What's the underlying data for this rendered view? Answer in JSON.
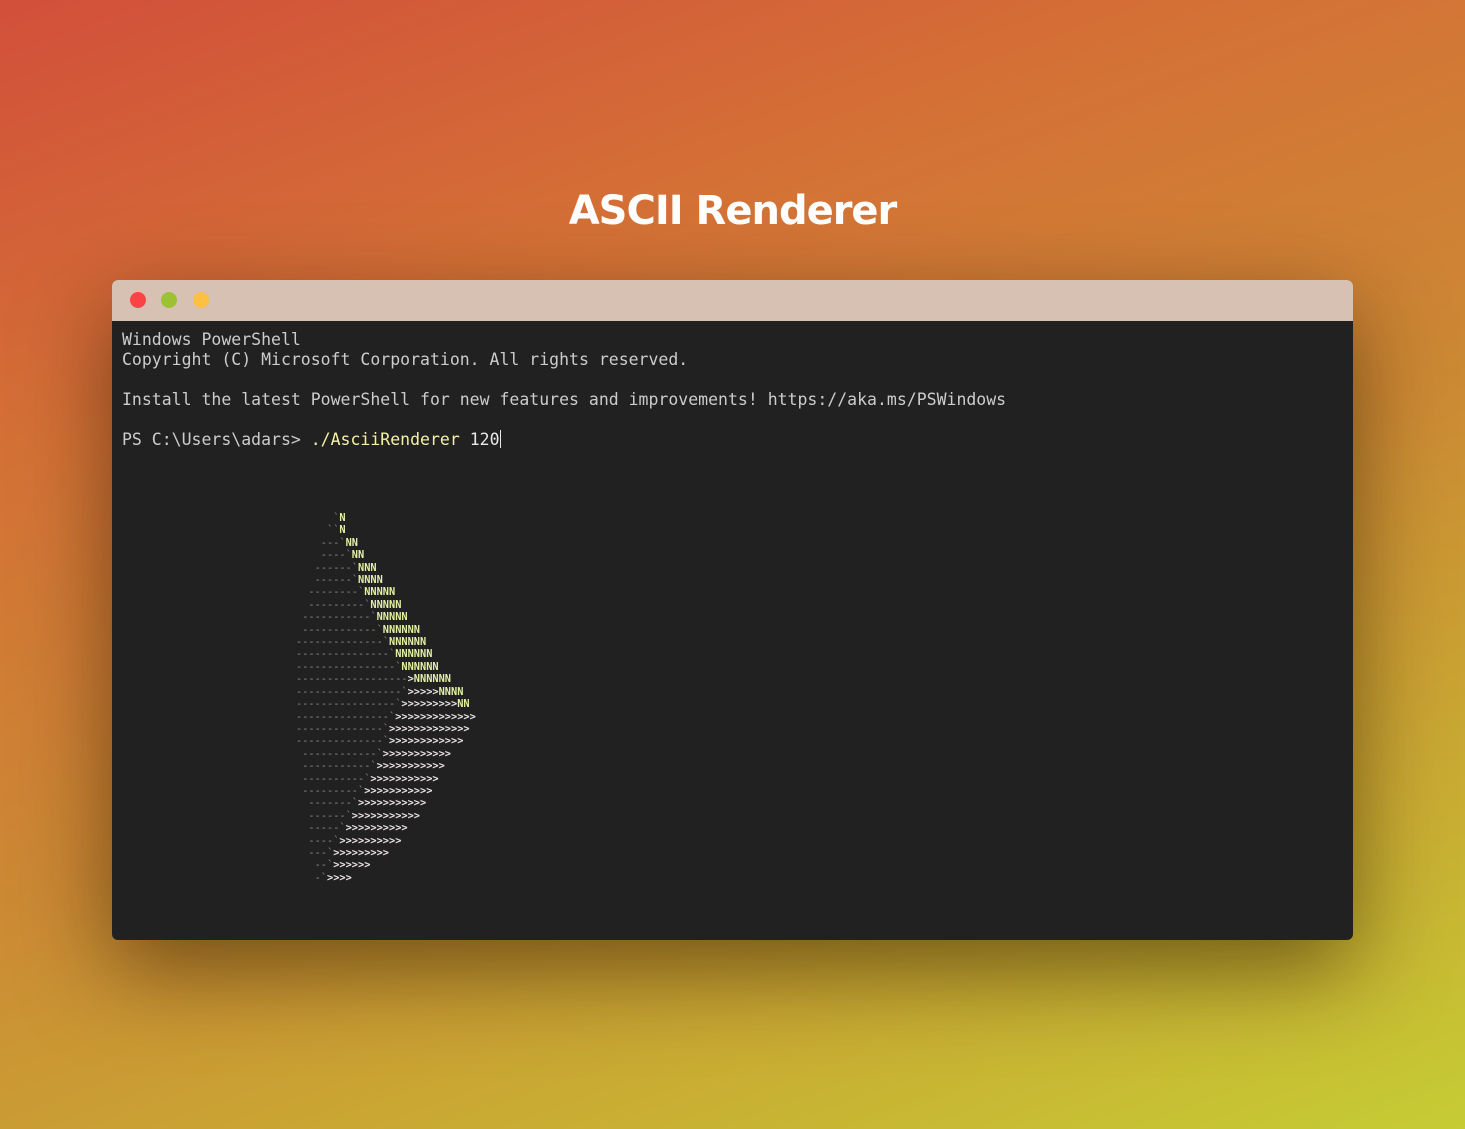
{
  "page": {
    "title": "ASCII Renderer"
  },
  "window": {
    "buttons": {
      "close": "close-button",
      "minimize": "minimize-button",
      "maximize": "maximize-button"
    },
    "colors": {
      "close": "#fb4346",
      "minimize": "#9dc134",
      "maximize": "#fdbf44",
      "titlebar": "#d6c1b2",
      "terminal_bg": "#212121"
    }
  },
  "terminal": {
    "header_line1": "Windows PowerShell",
    "header_line2": "Copyright (C) Microsoft Corporation. All rights reserved.",
    "install_line": "Install the latest PowerShell for new features and improvements! https://aka.ms/PSWindows",
    "prompt": "PS C:\\Users\\adars> ",
    "command": "./AsciiRenderer",
    "argument": " 120",
    "ascii_art": [
      "      `N",
      "     ``N",
      "    ---`NN",
      "    ----`NN",
      "   ------`NNN",
      "   ------`NNNN",
      "  --------`NNNNN",
      "  ---------`NNNNN",
      " -----------`NNNNN",
      " ------------`NNNNNN",
      "--------------`NNNNNN",
      "---------------`NNNNNN",
      "----------------`NNNNNN",
      "------------------>NNNNNN",
      "-----------------`>>>>>NNNN",
      "----------------`>>>>>>>>>NN",
      "---------------`>>>>>>>>>>>>>",
      "--------------`>>>>>>>>>>>>>",
      "--------------`>>>>>>>>>>>>",
      " ------------`>>>>>>>>>>>",
      " -----------`>>>>>>>>>>>",
      " ----------`>>>>>>>>>>>",
      " ---------`>>>>>>>>>>>",
      "  -------`>>>>>>>>>>>",
      "  ------`>>>>>>>>>>>",
      "  -----`>>>>>>>>>>",
      "  ----`>>>>>>>>>>",
      "  ---`>>>>>>>>>",
      "   --`>>>>>>",
      "   -`>>>>"
    ]
  }
}
